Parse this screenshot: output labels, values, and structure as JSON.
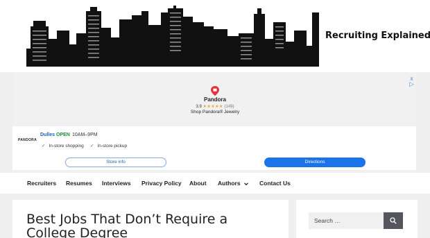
{
  "header": {
    "site_title": "Recruiting Explained"
  },
  "ad": {
    "close_glyph": "x",
    "info_glyph": "▷",
    "pin_icon": "map-pin-icon",
    "brand": "Pandora",
    "rating": "3.9",
    "stars": "★★★★★",
    "review_count": "(149)",
    "tagline": "Shop Pandora® Jewelry",
    "store": {
      "logo": "PANDORA",
      "location": "Dulles",
      "status": "OPEN",
      "hours": "10AM–9PM",
      "feature_1": "In-store shopping",
      "feature_2": "In-store pickup",
      "check_glyph": "✓",
      "store_info_label": "Store info",
      "directions_label": "Directions"
    },
    "colors": {
      "link_blue": "#1a5fb4",
      "button_blue": "#1a73e8",
      "open_green": "#1f8a3a",
      "pin_red": "#e2343a"
    }
  },
  "nav": {
    "items": [
      "Recruiters",
      "Resumes",
      "Interviews",
      "Privacy Policy",
      "About",
      "Authors",
      "Contact Us"
    ],
    "dropdown_icon": "chevron-down-icon"
  },
  "post": {
    "title": "Best Jobs That Don’t Require a College Degree"
  },
  "sidebar": {
    "search_placeholder": "Search …",
    "search_icon": "search-icon"
  }
}
